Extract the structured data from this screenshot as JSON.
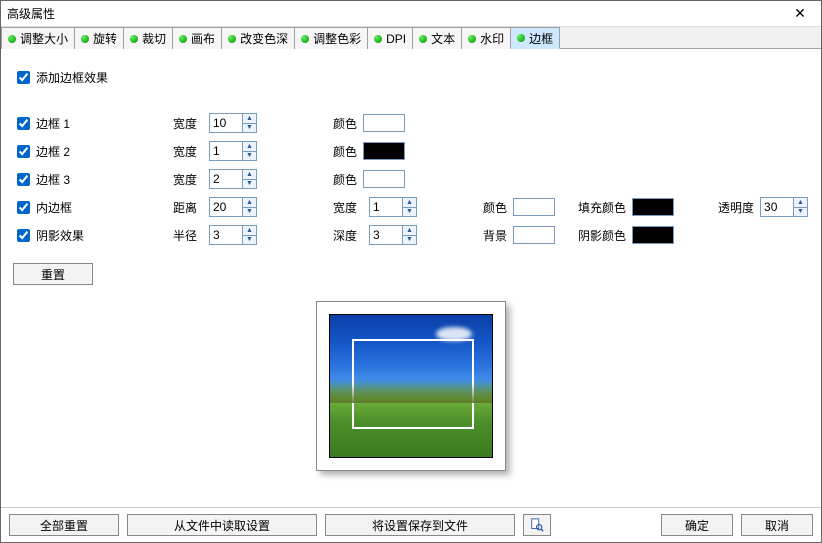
{
  "window": {
    "title": "高级属性"
  },
  "tabs": [
    {
      "label": "调整大小"
    },
    {
      "label": "旋转"
    },
    {
      "label": "裁切"
    },
    {
      "label": "画布"
    },
    {
      "label": "改变色深"
    },
    {
      "label": "调整色彩"
    },
    {
      "label": "DPI"
    },
    {
      "label": "文本"
    },
    {
      "label": "水印"
    },
    {
      "label": "边框"
    }
  ],
  "active_tab": 9,
  "enable": {
    "label": "添加边框效果",
    "checked": true
  },
  "borders": {
    "b1": {
      "label": "边框 1",
      "width_label": "宽度",
      "width": "10",
      "color_label": "颜色",
      "color": "#ffffff"
    },
    "b2": {
      "label": "边框 2",
      "width_label": "宽度",
      "width": "1",
      "color_label": "颜色",
      "color": "#000000"
    },
    "b3": {
      "label": "边框 3",
      "width_label": "宽度",
      "width": "2",
      "color_label": "颜色",
      "color": "#ffffff"
    }
  },
  "inner": {
    "label": "内边框",
    "distance_label": "距离",
    "distance": "20",
    "width_label": "宽度",
    "width": "1",
    "color_label": "颜色",
    "color": "#ffffff",
    "fill_label": "填充颜色",
    "fill": "#000000",
    "opacity_label": "透明度",
    "opacity": "30"
  },
  "shadow": {
    "label": "阴影效果",
    "radius_label": "半径",
    "radius": "3",
    "depth_label": "深度",
    "depth": "3",
    "bg_label": "背景",
    "bg": "#ffffff",
    "color_label": "阴影颜色",
    "color": "#000000"
  },
  "reset_btn": "重置",
  "footer": {
    "reset_all": "全部重置",
    "load": "从文件中读取设置",
    "save": "将设置保存到文件",
    "ok": "确定",
    "cancel": "取消"
  }
}
